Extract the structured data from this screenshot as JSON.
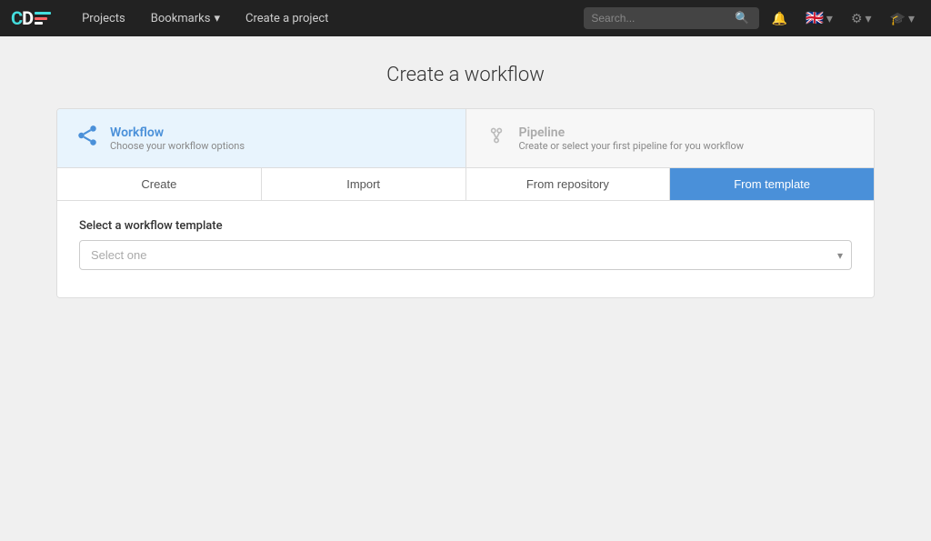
{
  "navbar": {
    "brand": "CD",
    "nav_items": [
      {
        "label": "Projects",
        "id": "projects"
      },
      {
        "label": "Bookmarks",
        "id": "bookmarks",
        "hasArrow": true
      },
      {
        "label": "Create a project",
        "id": "create-project"
      }
    ],
    "search_placeholder": "Search...",
    "icons": {
      "bell": "🔔",
      "flag": "🇬🇧",
      "settings": "⚙",
      "user": "🎓"
    }
  },
  "page": {
    "title": "Create a workflow"
  },
  "wizard": {
    "steps": [
      {
        "id": "workflow",
        "name": "Workflow",
        "description": "Choose your workflow options",
        "active": true
      },
      {
        "id": "pipeline",
        "name": "Pipeline",
        "description": "Create or select your first pipeline for you workflow",
        "active": false
      }
    ],
    "tabs": [
      {
        "id": "create",
        "label": "Create",
        "active": false
      },
      {
        "id": "import",
        "label": "Import",
        "active": false
      },
      {
        "id": "from-repository",
        "label": "From repository",
        "active": false
      },
      {
        "id": "from-template",
        "label": "From template",
        "active": true
      }
    ],
    "template_section": {
      "label": "Select a workflow template",
      "select_placeholder": "Select one"
    }
  }
}
